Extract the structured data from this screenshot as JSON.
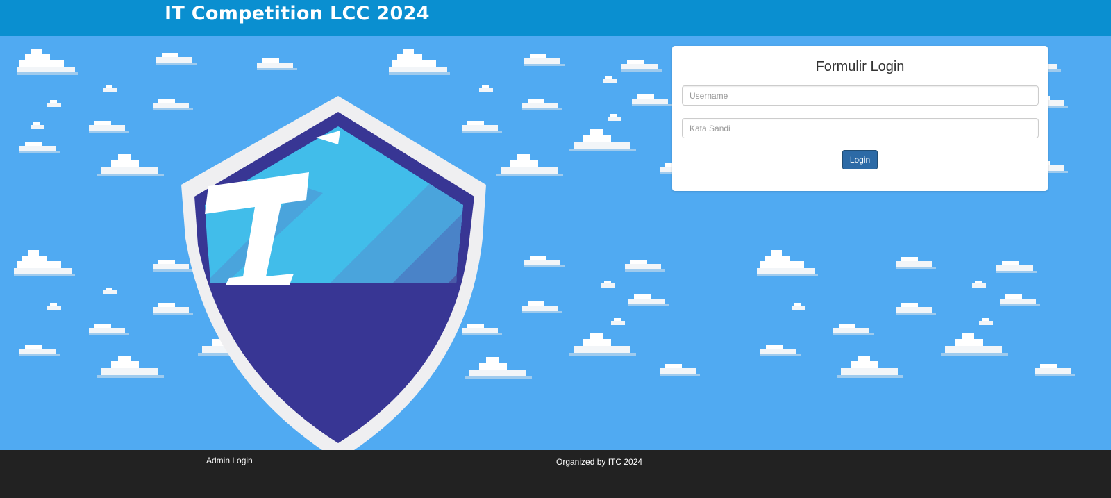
{
  "header": {
    "title": "IT Competition LCC 2024",
    "background_color": "#0a8fd0"
  },
  "hero": {
    "sky_color": "#50aaf2",
    "logo": {
      "icon": "shield-logo-icon",
      "letter": "I",
      "colors": {
        "outer": "#f0f0f2",
        "inner": "#383694",
        "accent": "#41bdea"
      }
    }
  },
  "login_form": {
    "title": "Formulir Login",
    "username": {
      "value": "",
      "placeholder": "Username"
    },
    "password": {
      "value": "",
      "placeholder": "Kata Sandi"
    },
    "submit_label": "Login",
    "button_color": "#2c6aa6"
  },
  "footer": {
    "admin_link": "Admin Login",
    "credit": "Organized by ITC 2024",
    "background_color": "#222222"
  }
}
